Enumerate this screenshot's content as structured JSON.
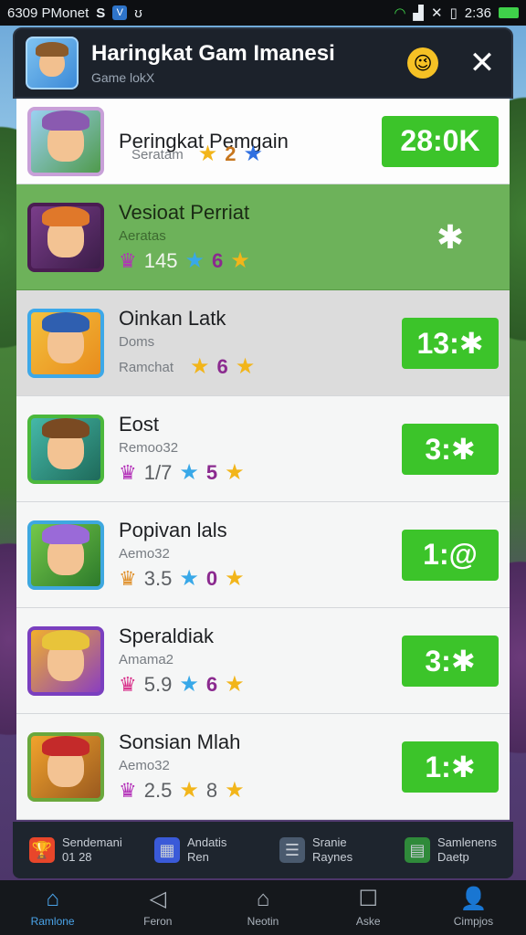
{
  "status_bar": {
    "left_text": "6309 PMonet",
    "left_icons": [
      "S",
      "V",
      "ʊ"
    ],
    "time": "2:36"
  },
  "dialog": {
    "title": "Haringkat Gam Imanesi",
    "subtitle": "Game lokX",
    "close_glyph": "✕",
    "emoji_glyph": "😉"
  },
  "rows": [
    {
      "name": "Peringkat Pemgain",
      "sub": "Seratam",
      "stats": [
        {
          "k": "star-gold"
        },
        {
          "v": "2",
          "c": "orange"
        },
        {
          "k": "star-blue"
        }
      ],
      "score": "28:0K"
    },
    {
      "name": "Vesioat Perriat",
      "sub": "Aeratas",
      "stats": [
        {
          "k": "crown"
        },
        {
          "v": "145"
        },
        {
          "k": "star-cyan"
        },
        {
          "v": "6",
          "c": "purple"
        },
        {
          "k": "star-gold"
        }
      ],
      "score": "✱"
    },
    {
      "name": "Oinkan Latk",
      "sub": "Doms",
      "sub2": "Ramchat",
      "stats": [
        {
          "k": "star-gold"
        },
        {
          "v": "6",
          "c": "purple"
        },
        {
          "k": "star-gold"
        }
      ],
      "score": "13:✱"
    },
    {
      "name": "Eost",
      "sub": "Remoo32",
      "stats": [
        {
          "k": "crown"
        },
        {
          "v": "1/7"
        },
        {
          "k": "star-cyan"
        },
        {
          "v": "5",
          "c": "purple"
        },
        {
          "k": "star-gold"
        }
      ],
      "score": "3:✱"
    },
    {
      "name": "Popivan lals",
      "sub": "Aemo32",
      "stats": [
        {
          "k": "crown"
        },
        {
          "v": "3.5"
        },
        {
          "k": "star-cyan"
        },
        {
          "v": "0",
          "c": "purple"
        },
        {
          "k": "star-gold"
        }
      ],
      "score": "1:@"
    },
    {
      "name": "Speraldiak",
      "sub": "Amama2",
      "stats": [
        {
          "k": "crown"
        },
        {
          "v": "5.9"
        },
        {
          "k": "star-cyan"
        },
        {
          "v": "6",
          "c": "purple"
        },
        {
          "k": "star-gold"
        }
      ],
      "score": "3:✱"
    },
    {
      "name": "Sonsian Mlah",
      "sub": "Aemo32",
      "stats": [
        {
          "k": "crown"
        },
        {
          "v": "2.5"
        },
        {
          "k": "star-gold"
        },
        {
          "v": "8"
        },
        {
          "k": "star-gold"
        }
      ],
      "score": "1:✱"
    }
  ],
  "bottom_strip": [
    {
      "icon": "trophy-icon",
      "line1": "Sendemani",
      "line2": "01 28"
    },
    {
      "icon": "shop-icon",
      "line1": "Andatis",
      "line2": "Ren"
    },
    {
      "icon": "list-icon",
      "line1": "Sranie",
      "line2": "Raynes"
    },
    {
      "icon": "chart-icon",
      "line1": "Samlenens",
      "line2": "Daetp"
    }
  ],
  "nav": [
    {
      "label": "Ramlone",
      "glyph": "⌂"
    },
    {
      "label": "Feron",
      "glyph": "◁"
    },
    {
      "label": "Neotin",
      "glyph": "⌂"
    },
    {
      "label": "Aske",
      "glyph": "☐"
    },
    {
      "label": "Cimpjos",
      "glyph": "👤"
    }
  ],
  "colors": {
    "score_green": "#3cc42a",
    "highlight_row": "#6db25a",
    "nav_active": "#4aa3e8"
  }
}
